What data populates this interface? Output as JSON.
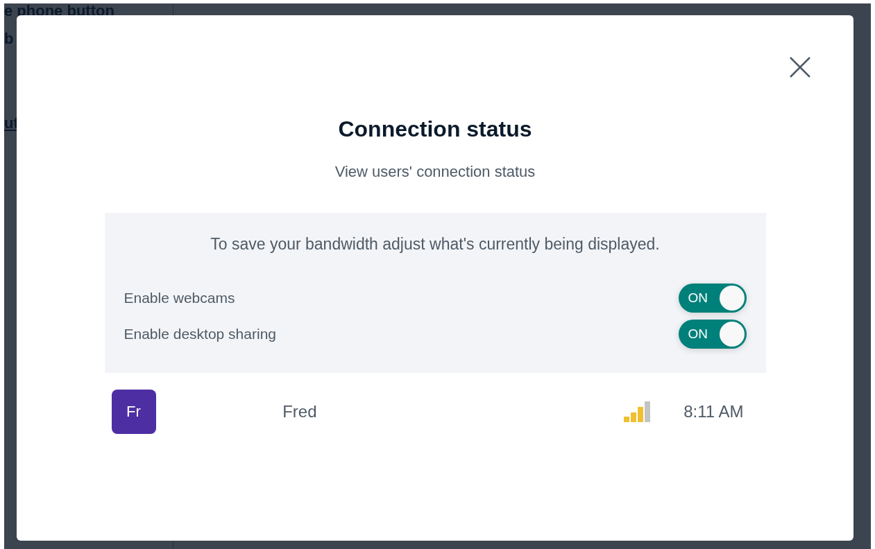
{
  "background": {
    "texts": [
      {
        "text": "e phone button",
        "kind": "bold"
      },
      {
        "text": "b",
        "kind": "bold"
      },
      {
        "text": "ut",
        "kind": "link"
      }
    ]
  },
  "modal": {
    "title": "Connection status",
    "subtitle": "View users' connection status",
    "settings": {
      "intro": "To save your bandwidth adjust what's currently being displayed.",
      "toggles": [
        {
          "label": "Enable webcams",
          "on": true,
          "state_text": "ON"
        },
        {
          "label": "Enable desktop sharing",
          "on": true,
          "state_text": "ON"
        }
      ]
    },
    "users": [
      {
        "initials": "Fr",
        "name": "Fred",
        "color": "#4e2ea3",
        "time": "8:11 AM"
      }
    ]
  }
}
